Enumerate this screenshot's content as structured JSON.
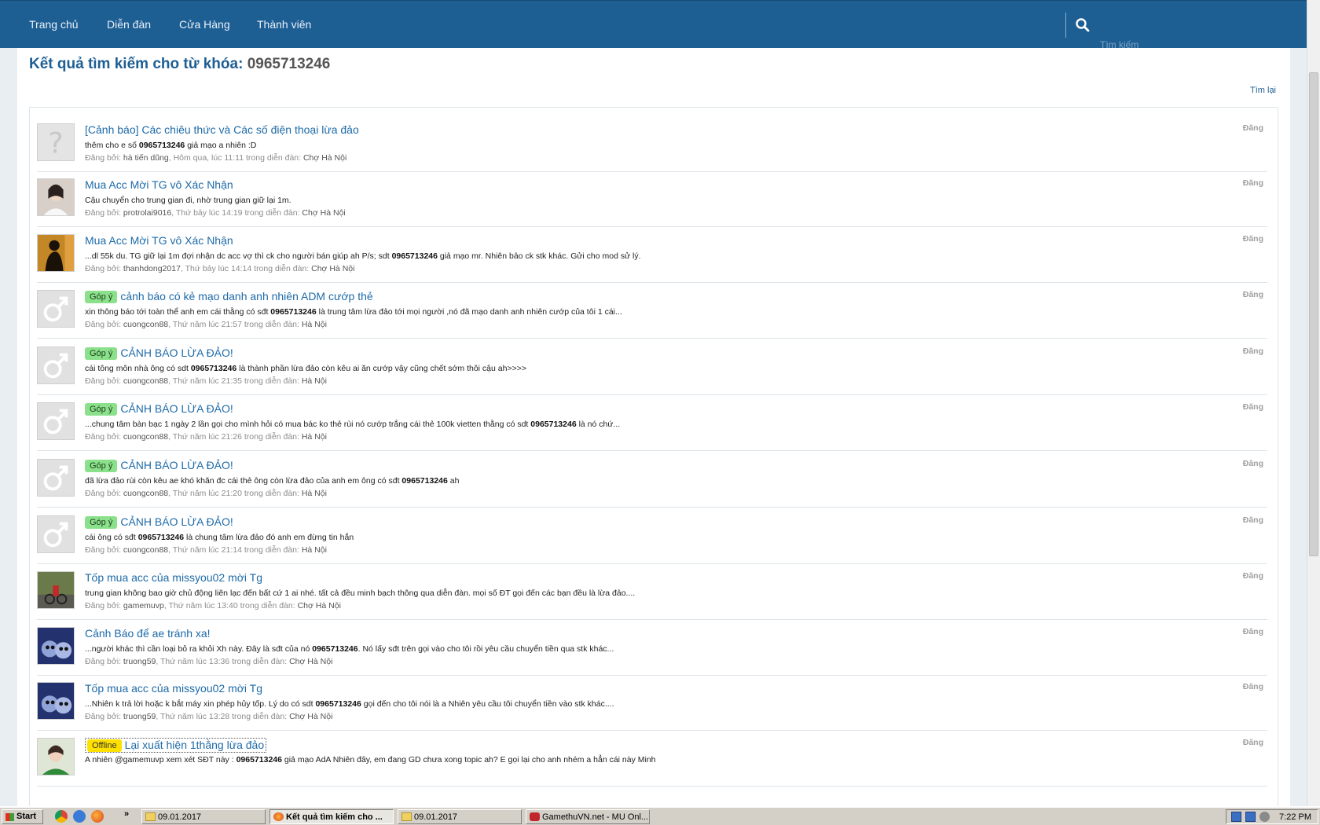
{
  "nav": {
    "items": [
      "Trang chủ",
      "Diễn đàn",
      "Cửa Hàng",
      "Thành viên"
    ],
    "search_placeholder": "Tìm kiếm"
  },
  "page": {
    "title_prefix": "Kết quả tìm kiếm cho từ khóa:",
    "keyword": "0965713246",
    "refine_link": "Tìm lại"
  },
  "results": [
    {
      "avatar": "unknown",
      "tag": "",
      "title": "[Cảnh báo] Các chiêu thức và Các số điện thoại lừa đảo",
      "pre": "thêm cho e số ",
      "hit": "0965713246",
      "post": " giả mạo a nhiên :D",
      "posted_by": "Đăng bởi:",
      "user": "hà tiến dũng",
      "time": ", Hôm qua, lúc 11:11 trong diễn đàn:",
      "forum": "Chợ Hà Nội",
      "side": "Đăng"
    },
    {
      "avatar": "photo-woman",
      "tag": "",
      "title": "Mua Acc Mời TG vô Xác Nhận",
      "pre": "Cậu chuyển cho trung gian đi, nhờ trung gian giữ lại 1m.",
      "hit": "",
      "post": "",
      "posted_by": "Đăng bởi:",
      "user": "protrolai9016",
      "time": ", Thứ bảy lúc 14:19 trong diễn đàn:",
      "forum": "Chợ Hà Nội",
      "side": "Đăng"
    },
    {
      "avatar": "photo-silhouette",
      "tag": "",
      "title": "Mua Acc Mời TG vô Xác Nhận",
      "pre": "...dl 55k du. TG giữ lại 1m đợi nhận dc acc vợ thì ck cho người bán giúp ah P/s; sdt ",
      "hit": "0965713246",
      "post": " giả mạo mr. Nhiên bảo ck stk khác. Gửi cho mod sử lý.",
      "posted_by": "Đăng bởi:",
      "user": "thanhdong2017",
      "time": ", Thứ bảy lúc 14:14 trong diễn đàn:",
      "forum": "Chợ Hà Nội",
      "side": "Đăng"
    },
    {
      "avatar": "male",
      "tag": "Góp ý",
      "title": "cảnh báo có kẻ mạo danh anh nhiên ADM cướp thẻ",
      "pre": "xin thông báo tới toàn thể anh em cái thằng có sđt ",
      "hit": "0965713246",
      "post": " là trung tâm lừa đảo tới mọi người ,nó đã mạo danh anh nhiên cướp của tôi 1 cái...",
      "posted_by": "Đăng bởi:",
      "user": "cuongcon88",
      "time": ", Thứ năm lúc 21:57 trong diễn đàn:",
      "forum": "Hà Nội",
      "side": "Đăng"
    },
    {
      "avatar": "male",
      "tag": "Góp ý",
      "title": "CẢNH BÁO LỪA ĐẢO!",
      "pre": "cái tông môn nhà ông có sdt ",
      "hit": "0965713246",
      "post": " là thành phần lừa đảo còn kêu ai ăn cướp vậy cũng chết sớm thôi cậu ah>>>>",
      "posted_by": "Đăng bởi:",
      "user": "cuongcon88",
      "time": ", Thứ năm lúc 21:35 trong diễn đàn:",
      "forum": "Hà Nội",
      "side": "Đăng"
    },
    {
      "avatar": "male",
      "tag": "Góp ý",
      "title": "CẢNH BÁO LỪA ĐẢO!",
      "pre": "...chung tâm bàn bạc 1 ngày 2 lần gọi cho mình hỏi có mua bác ko thẻ rùi nó cướp trắng cái thẻ 100k vietten thằng có sdt ",
      "hit": "0965713246",
      "post": " là nó chứ...",
      "posted_by": "Đăng bởi:",
      "user": "cuongcon88",
      "time": ", Thứ năm lúc 21:26 trong diễn đàn:",
      "forum": "Hà Nội",
      "side": "Đăng"
    },
    {
      "avatar": "male",
      "tag": "Góp ý",
      "title": "CẢNH BÁO LỪA ĐẢO!",
      "pre": "đã lừa đảo rùi còn kêu ae khó khăn đc cái thẻ ông còn lừa đảo của anh em ông có sđt ",
      "hit": "0965713246",
      "post": " ah",
      "posted_by": "Đăng bởi:",
      "user": "cuongcon88",
      "time": ", Thứ năm lúc 21:20 trong diễn đàn:",
      "forum": "Hà Nội",
      "side": "Đăng"
    },
    {
      "avatar": "male",
      "tag": "Góp ý",
      "title": "CẢNH BÁO LỪA ĐẢO!",
      "pre": "cái ông có sđt ",
      "hit": "0965713246",
      "post": " là chung tâm lừa đảo đó anh em đừng tin hắn",
      "posted_by": "Đăng bởi:",
      "user": "cuongcon88",
      "time": ", Thứ năm lúc 21:14 trong diễn đàn:",
      "forum": "Hà Nội",
      "side": "Đăng"
    },
    {
      "avatar": "photo-bike",
      "tag": "",
      "title": "Tốp mua acc của missyou02 mời Tg",
      "pre": "trung gian không bao giờ chủ động liên lạc đến bất cứ 1 ai nhé. tất cả đều minh bạch thông qua diễn đàn. mọi số ĐT gọi đến các bạn đều là lừa đảo....",
      "hit": "",
      "post": "",
      "posted_by": "Đăng bởi:",
      "user": "gamemuvp",
      "time": ", Thứ năm lúc 13:40 trong diễn đàn:",
      "forum": "Chợ Hà Nội",
      "side": "Đăng"
    },
    {
      "avatar": "photo-cats",
      "tag": "",
      "title": "Cảnh Báo để ae tránh xa!",
      "pre": "...người khác thì cần loại bỏ ra khỏi Xh này. Đây là sđt của nó ",
      "hit": "0965713246",
      "post": ". Nó lấy sđt trên gọi vào cho tôi rồi yêu cầu chuyển tiền qua stk khác...",
      "posted_by": "Đăng bởi:",
      "user": "truong59",
      "time": ", Thứ năm lúc 13:36 trong diễn đàn:",
      "forum": "Chợ Hà Nội",
      "side": "Đăng"
    },
    {
      "avatar": "photo-cats",
      "tag": "",
      "title": "Tốp mua acc của missyou02 mời Tg",
      "pre": "...Nhiên k trả lời hoặc k bắt máy xin phép hủy tốp. Lý do có sdt ",
      "hit": "0965713246",
      "post": " gọi đến cho tôi nói là a Nhiên yêu cầu tôi chuyển tiền vào stk khác....",
      "posted_by": "Đăng bởi:",
      "user": "truong59",
      "time": ", Thứ năm lúc 13:28 trong diễn đàn:",
      "forum": "Chợ Hà Nội",
      "side": "Đăng"
    },
    {
      "avatar": "photo-girl",
      "tag": "Offline",
      "title": "Lại xuất hiện 1thằng lừa đảo",
      "pre": "A nhiên @gamemuvp xem xét SĐT này : ",
      "hit": "0965713246",
      "post": " giả mạo AdA Nhiên đây, em đang GD chưa xong topic ah? E gọi lại cho anh nhém a hẳn cái này Minh",
      "posted_by": "Đăng bởi:",
      "user": "",
      "time": "",
      "forum": "",
      "side": "Đăng"
    }
  ],
  "taskbar": {
    "start": "Start",
    "tasks": [
      "09.01.2017",
      "Kết quả tìm kiếm cho ...",
      "09.01.2017",
      "GamethuVN.net - MU Onl..."
    ],
    "chevron": "»",
    "clock": "7:22 PM"
  },
  "colors": {
    "nav_bg": "#1d5e93",
    "link": "#1d6aa8",
    "tag_gopy": "#8be08b",
    "tag_offline": "#ffe100"
  }
}
